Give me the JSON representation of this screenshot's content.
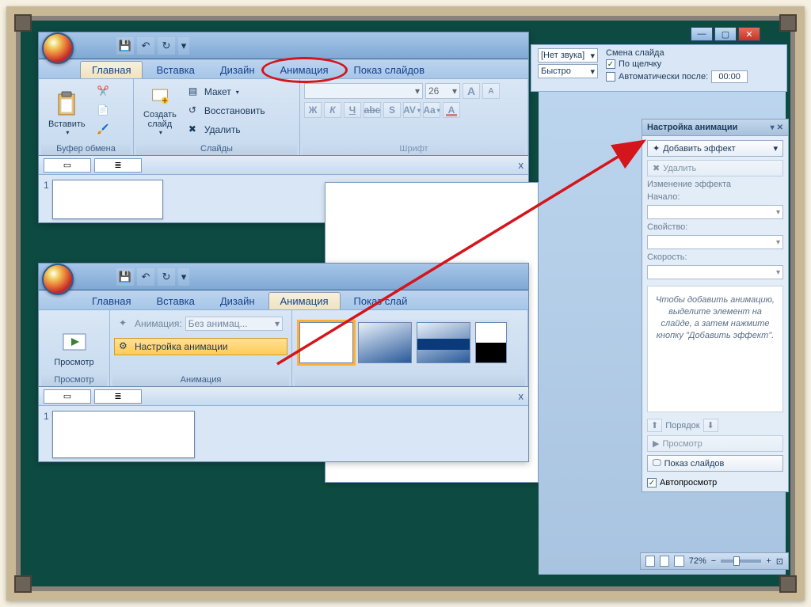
{
  "tabs": {
    "home": "Главная",
    "insert": "Вставка",
    "design": "Дизайн",
    "animation": "Анимация",
    "slideshow": "Показ слайдов",
    "slideshow_short": "Показ слай"
  },
  "ribbon1": {
    "paste": "Вставить",
    "clipboard_group": "Буфер обмена",
    "new_slide": "Создать\nслайд",
    "layout": "Макет",
    "reset": "Восстановить",
    "delete": "Удалить",
    "slides_group": "Слайды",
    "font_size": "26",
    "font_group": "Шрифт"
  },
  "ribbon2": {
    "preview": "Просмотр",
    "preview_group": "Просмотр",
    "anim_label": "Анимация:",
    "anim_value": "Без анимац...",
    "custom_anim": "Настройка анимации",
    "anim_group": "Анимация"
  },
  "transition": {
    "sound": "[Нет звука]",
    "speed": "Быстро",
    "advance_title": "Смена слайда",
    "on_click": "По щелчку",
    "auto_after": "Автоматически после:",
    "time": "00:00"
  },
  "taskpane": {
    "title": "Настройка анимации",
    "add_effect": "Добавить эффект",
    "remove": "Удалить",
    "modify": "Изменение эффекта",
    "start": "Начало:",
    "property": "Свойство:",
    "speed": "Скорость:",
    "hint": "Чтобы добавить анимацию, выделите элемент на слайде, а затем нажмите кнопку \"Добавить эффект\".",
    "reorder": "Порядок",
    "play": "Просмотр",
    "slideshow": "Показ слайдов",
    "autopreview": "Автопросмотр"
  },
  "status": {
    "zoom": "72%"
  },
  "outline": {
    "slide_number": "1",
    "close": "x"
  }
}
